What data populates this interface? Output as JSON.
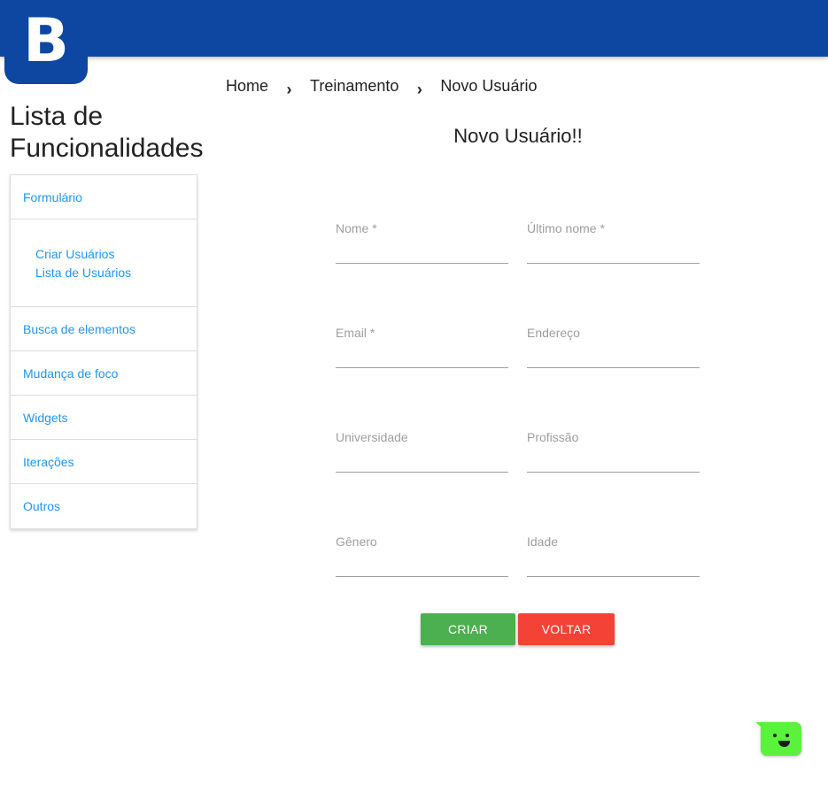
{
  "header": {
    "logo_letter": "B"
  },
  "breadcrumb": {
    "items": [
      "Home",
      "Treinamento",
      "Novo Usuário"
    ],
    "separator": "›"
  },
  "sidebar": {
    "title": "Lista de Funcionalidades",
    "sections": [
      {
        "label": "Formulário"
      },
      {
        "label": "Busca de elementos"
      },
      {
        "label": "Mudança de foco"
      },
      {
        "label": "Widgets"
      },
      {
        "label": "Iterações"
      },
      {
        "label": "Outros"
      }
    ],
    "form_links": [
      "Criar Usuários",
      "Lista de Usuários"
    ]
  },
  "form": {
    "title": "Novo Usuário!!",
    "fields": {
      "first_name": {
        "label": "Nome *",
        "value": ""
      },
      "last_name": {
        "label": "Último nome *",
        "value": ""
      },
      "email": {
        "label": "Email *",
        "value": ""
      },
      "address": {
        "label": "Endereço",
        "value": ""
      },
      "university": {
        "label": "Universidade",
        "value": ""
      },
      "profession": {
        "label": "Profissão",
        "value": ""
      },
      "gender": {
        "label": "Gênero",
        "value": ""
      },
      "age": {
        "label": "Idade",
        "value": ""
      }
    },
    "create_label": "Criar",
    "back_label": "Voltar"
  },
  "colors": {
    "header": "#0d47a1",
    "link": "#2196f3",
    "create": "#4caf50",
    "back": "#f44336",
    "chat": "#5af23a"
  },
  "icons": {
    "logo": "logo-b-icon",
    "breadcrumb_separator": "chevron-right-icon",
    "chat": "chat-bot-icon"
  }
}
